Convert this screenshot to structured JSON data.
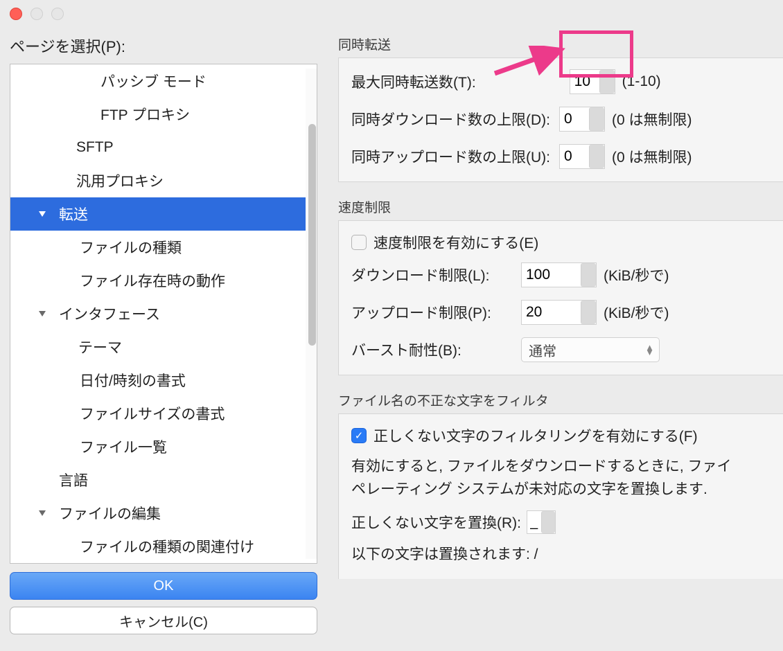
{
  "titlebar": {
    "close_color": "#ff5f57",
    "min_color": "#e6e6e6",
    "max_color": "#e6e6e6"
  },
  "sidebar": {
    "label": "ページを選択(P):",
    "items": [
      {
        "label": "パッシブ モード",
        "cls": "lvl-a"
      },
      {
        "label": "FTP プロキシ",
        "cls": "lvl-a"
      },
      {
        "label": "SFTP",
        "cls": "lvl-b"
      },
      {
        "label": "汎用プロキシ",
        "cls": "lvl-b"
      },
      {
        "label": "転送",
        "cls": "lvl-sel",
        "tri": true,
        "selected": true
      },
      {
        "label": "ファイルの種類",
        "cls": "lvl-sub"
      },
      {
        "label": "ファイル存在時の動作",
        "cls": "lvl-sub"
      },
      {
        "label": "インタフェース",
        "cls": "lvl-iface",
        "tri": true
      },
      {
        "label": "テーマ",
        "cls": "lvl-theme"
      },
      {
        "label": "日付/時刻の書式",
        "cls": "lvl-sub"
      },
      {
        "label": "ファイルサイズの書式",
        "cls": "lvl-sub"
      },
      {
        "label": "ファイル一覧",
        "cls": "lvl-sub"
      },
      {
        "label": "言語",
        "cls": "lvl-lang"
      },
      {
        "label": "ファイルの編集",
        "cls": "lvl-edit",
        "tri": true
      },
      {
        "label": "ファイルの種類の関連付け",
        "cls": "lvl-sub"
      }
    ],
    "ok_label": "OK",
    "cancel_label": "キャンセル(C)"
  },
  "groups": {
    "concurrent": {
      "title": "同時転送",
      "max_transfers_label": "最大同時転送数(T):",
      "max_transfers_value": "10",
      "max_transfers_hint": "(1-10)",
      "max_downloads_label": "同時ダウンロード数の上限(D):",
      "max_downloads_value": "0",
      "max_downloads_hint": "(0 は無制限)",
      "max_uploads_label": "同時アップロード数の上限(U):",
      "max_uploads_value": "0",
      "max_uploads_hint": "(0 は無制限)"
    },
    "speed": {
      "title": "速度制限",
      "enable_label": "速度制限を有効にする(E)",
      "download_label": "ダウンロード制限(L):",
      "download_value": "100",
      "download_unit": "(KiB/秒で)",
      "upload_label": "アップロード制限(P):",
      "upload_value": "20",
      "upload_unit": "(KiB/秒で)",
      "burst_label": "バースト耐性(B):",
      "burst_value": "通常"
    },
    "filter": {
      "title": "ファイル名の不正な文字をフィルタ",
      "enable_label": "正しくない文字のフィルタリングを有効にする(F)",
      "description": "有効にすると, ファイルをダウンロードするときに, ファイ\nペレーティング システムが未対応の文字を置換します.",
      "replace_label": "正しくない文字を置換(R):",
      "replace_value": "_",
      "following_label": "以下の文字は置換されます: /"
    }
  }
}
